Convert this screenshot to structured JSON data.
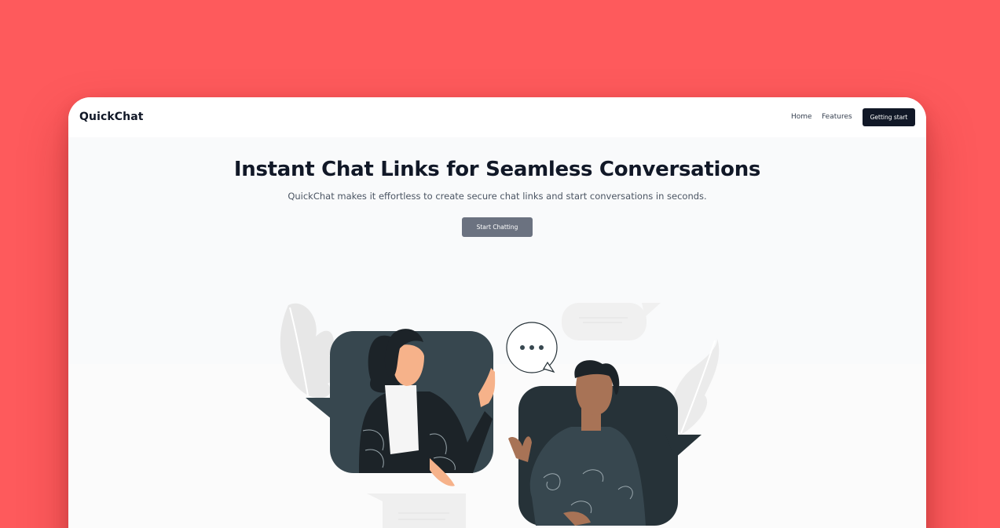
{
  "app": {
    "name": "QuickChat"
  },
  "nav": {
    "links": [
      "Home",
      "Features"
    ],
    "cta_label": "Getting start"
  },
  "hero": {
    "title": "Instant Chat Links for Seamless Conversations",
    "subtitle": "QuickChat makes it effortless to create secure chat links and start conversations in seconds.",
    "button_label": "Start Chatting"
  },
  "colors": {
    "background": "#fe5a5c",
    "primary": "#111827",
    "button_secondary": "#6b7280",
    "illustration_dark": "#37474f"
  },
  "illustration": {
    "elements": [
      "leaf-icon",
      "chat-bubble-icon",
      "woman-avatar",
      "man-avatar",
      "typing-dots-icon"
    ]
  }
}
